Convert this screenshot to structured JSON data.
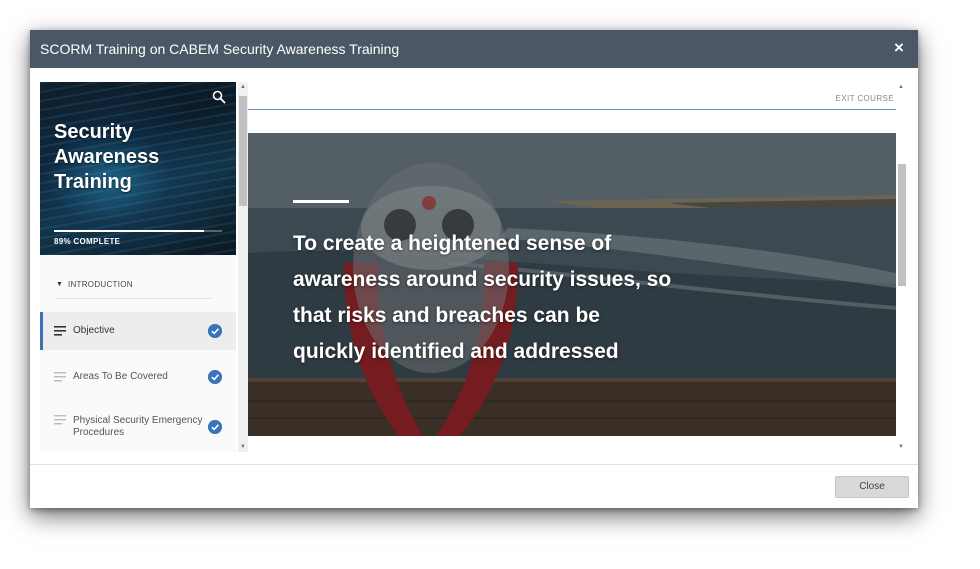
{
  "modal": {
    "title": "SCORM Training on CABEM Security Awareness Training",
    "close_symbol": "×"
  },
  "course": {
    "title": "Security\nAwareness\nTraining",
    "progress_percent": 89,
    "progress_label": "89% COMPLETE",
    "search_icon": "search-icon"
  },
  "outline": {
    "section_label": "INTRODUCTION",
    "lessons": [
      {
        "label": "Objective",
        "active": true,
        "completed": true
      },
      {
        "label": "Areas To Be Covered",
        "active": false,
        "completed": true
      },
      {
        "label": "Physical Security Emergency Procedures",
        "active": false,
        "completed": true
      }
    ]
  },
  "content": {
    "exit_label": "EXIT COURSE",
    "headline": "To create a heightened sense of awareness around security issues, so that risks and breaches can be quickly identified and addressed"
  },
  "footer": {
    "close_label": "Close"
  },
  "colors": {
    "header_bg": "#4c5766",
    "accent": "#3b73b9"
  }
}
